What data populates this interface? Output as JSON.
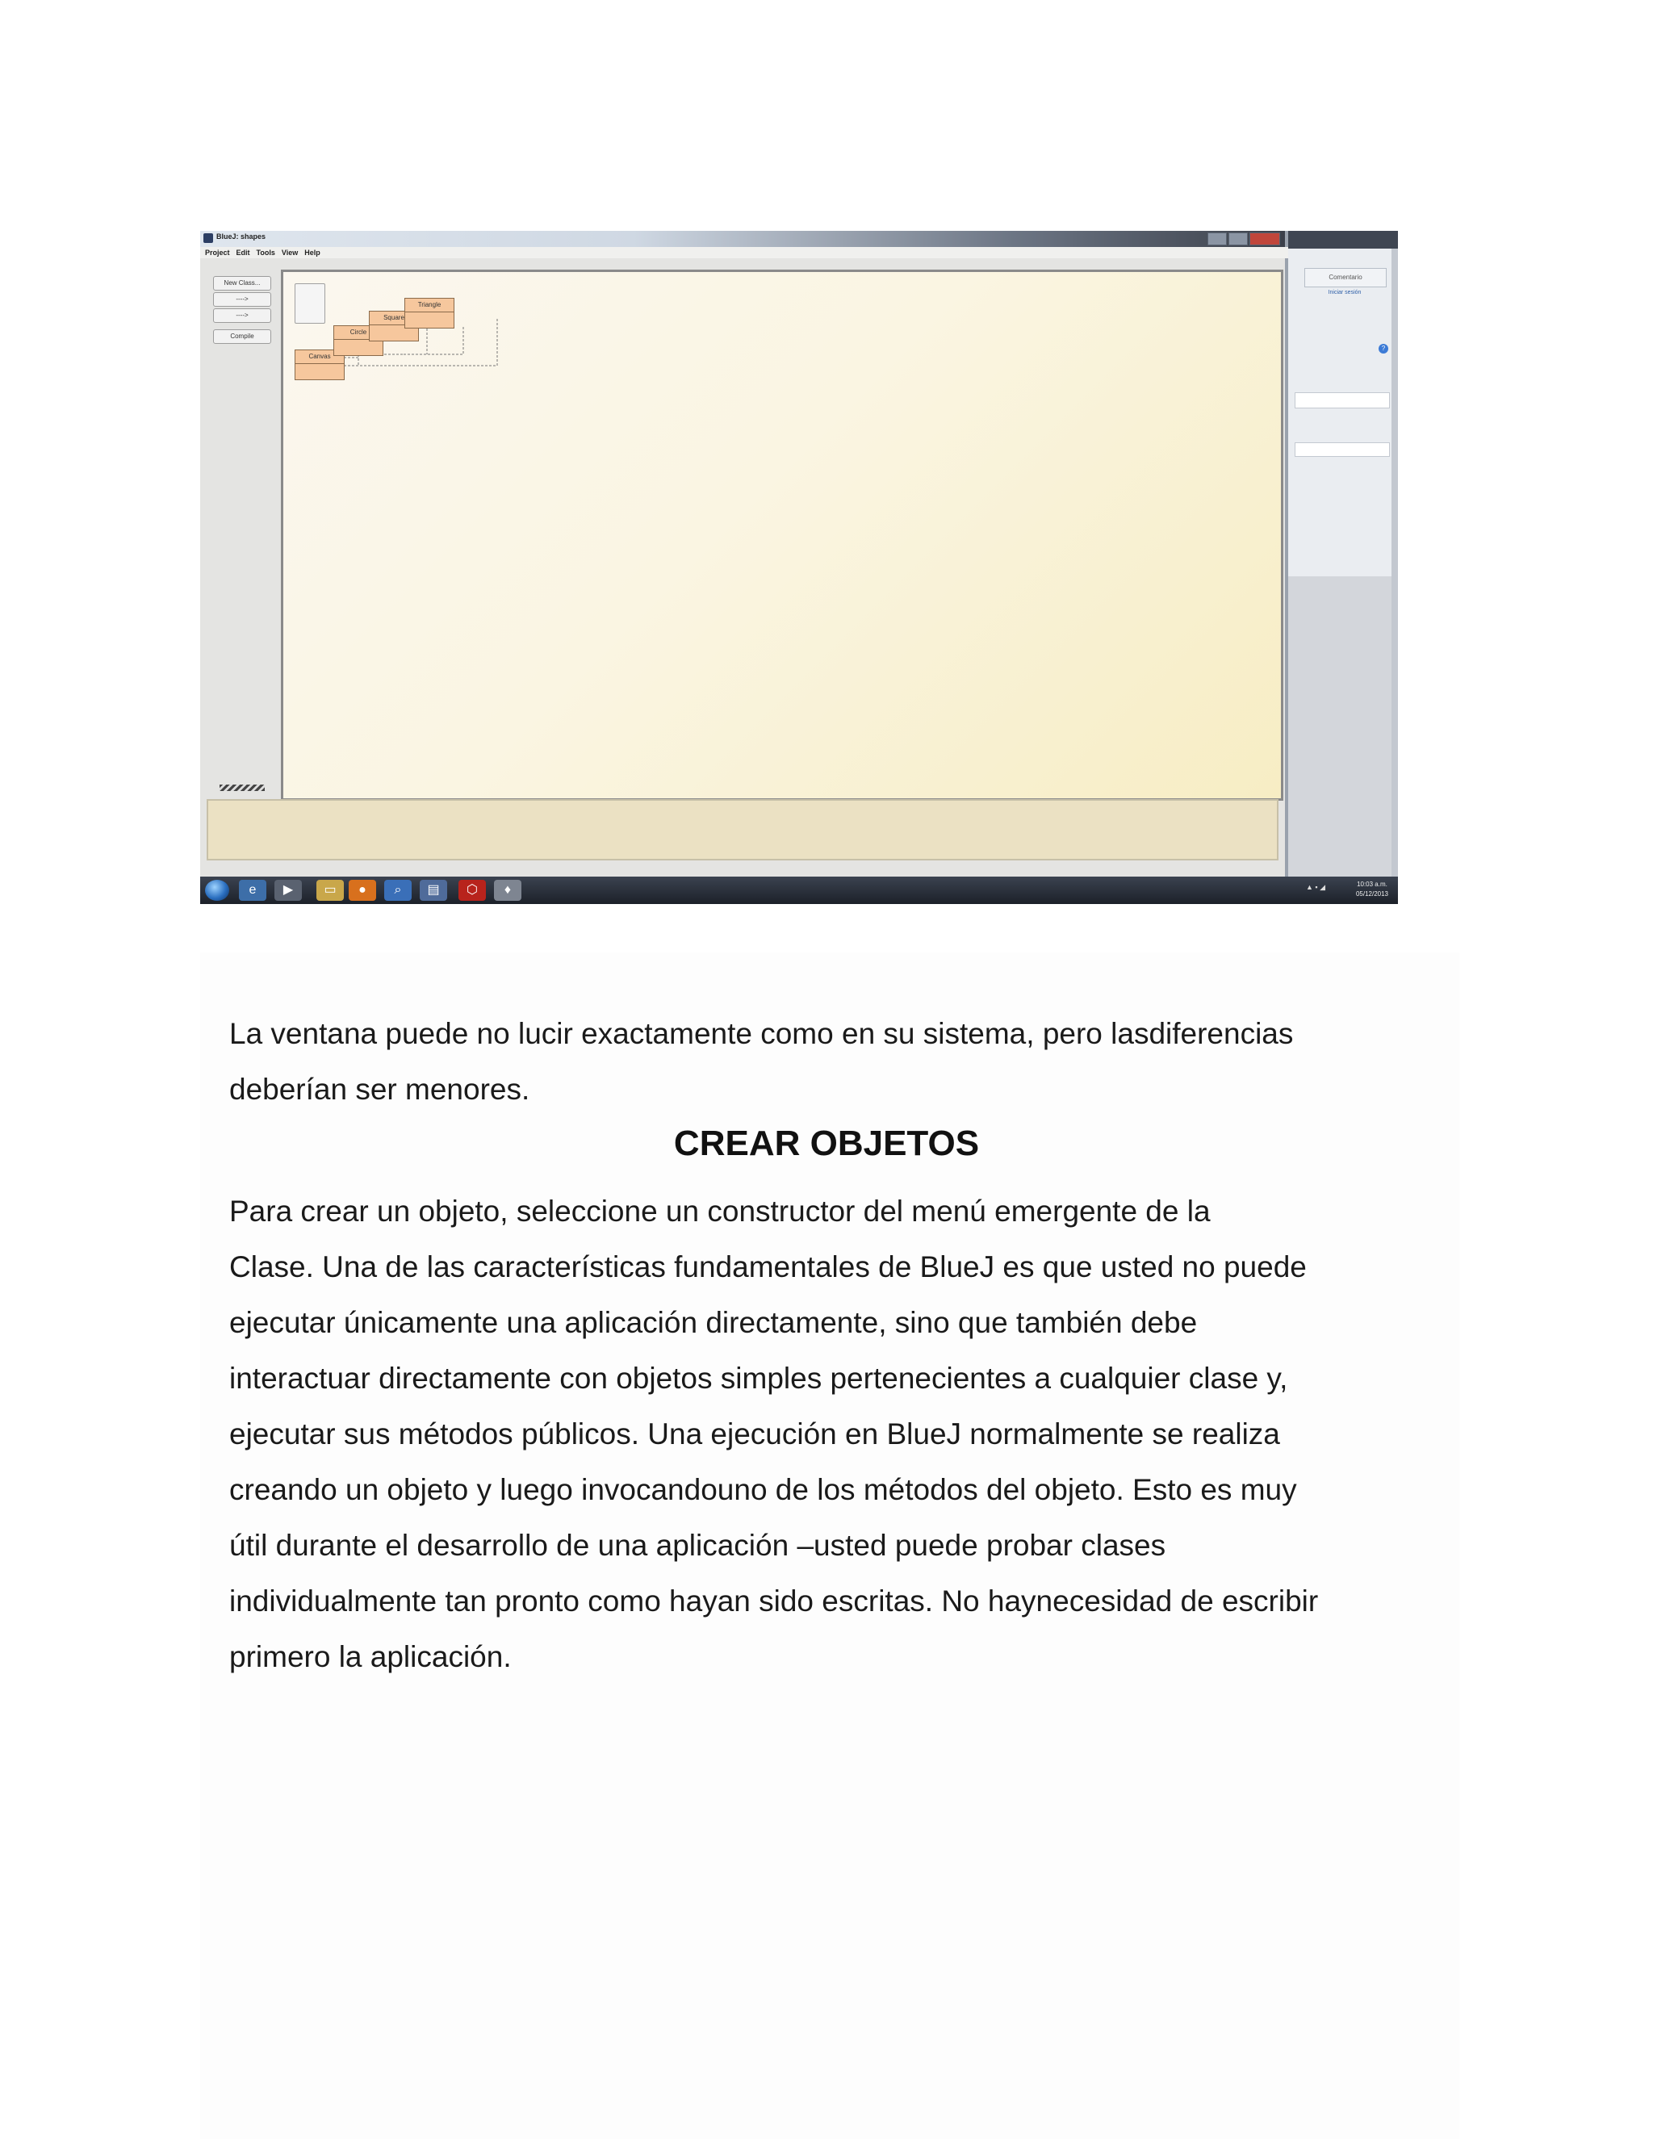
{
  "screenshot": {
    "window_title": "BlueJ: shapes",
    "menu": [
      "Project",
      "Edit",
      "Tools",
      "View",
      "Help"
    ],
    "side_buttons": [
      "New Class...",
      "---->",
      "---->",
      "Compile"
    ],
    "classes": [
      "Canvas",
      "Circle",
      "Square",
      "Triangle"
    ],
    "right_panel": {
      "button": "Comentario",
      "link": "Iniciar sesión"
    },
    "taskbar": {
      "clock_time": "10:03 a.m.",
      "clock_date": "05/12/2013"
    }
  },
  "document": {
    "para1_line1": "La ventana puede no lucir exactamente como en su sistema, pero lasdiferencias",
    "para1_line2": "deberían ser menores.",
    "heading": "CREAR OBJETOS",
    "para2_lines": [
      "Para crear un objeto, seleccione un constructor del menú emergente de la",
      "Clase. Una de las características fundamentales de BlueJ es que usted no puede",
      "ejecutar únicamente una aplicación directamente, sino que también debe",
      "interactuar directamente con objetos simples pertenecientes a cualquier clase y,",
      "ejecutar sus métodos públicos. Una ejecución en BlueJ normalmente se realiza",
      "creando un objeto y luego invocandouno de los métodos del objeto. Esto es muy",
      "útil durante el desarrollo de una aplicación –usted puede probar clases",
      "individualmente tan pronto como hayan sido escritas. No haynecesidad de escribir",
      "primero la aplicación."
    ]
  }
}
